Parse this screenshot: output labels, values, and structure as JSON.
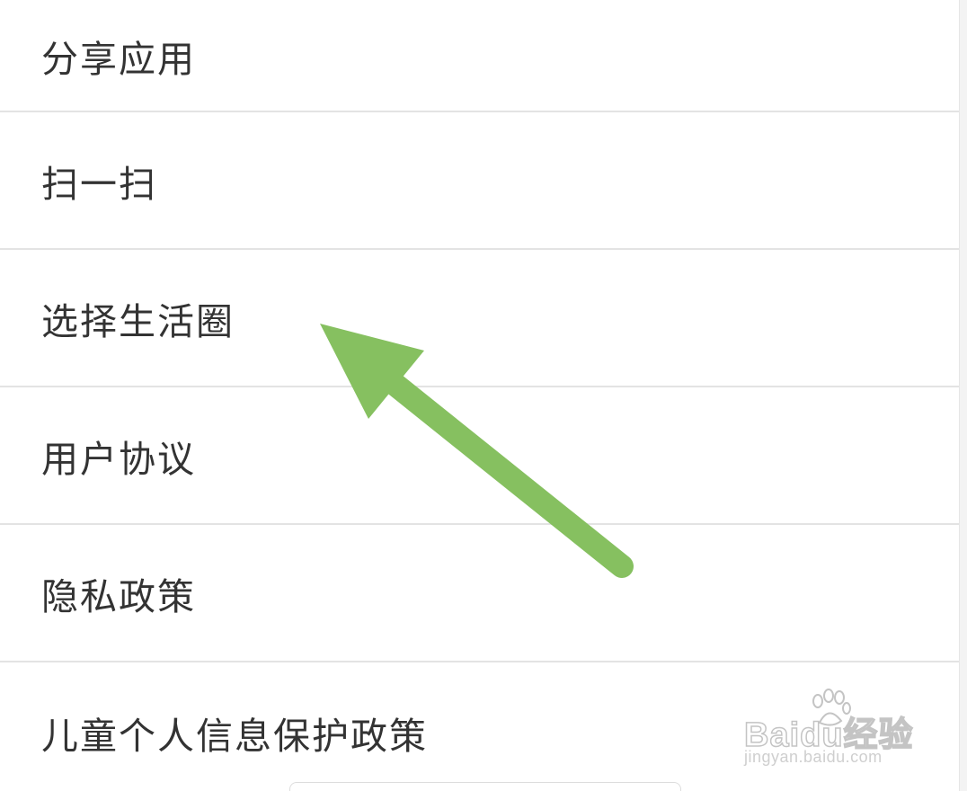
{
  "menu": {
    "items": [
      {
        "label": "分享应用"
      },
      {
        "label": "扫一扫"
      },
      {
        "label": "选择生活圈"
      },
      {
        "label": "用户协议"
      },
      {
        "label": "隐私政策"
      },
      {
        "label": "儿童个人信息保护政策"
      }
    ]
  },
  "annotation": {
    "arrow_color": "#86c060",
    "points_to": "选择生活圈"
  },
  "watermark": {
    "logo_text": "Baidu经验",
    "url": "jingyan.baidu.com"
  },
  "colors": {
    "text": "#333333",
    "divider": "#e3e3e3",
    "background": "#ffffff"
  }
}
